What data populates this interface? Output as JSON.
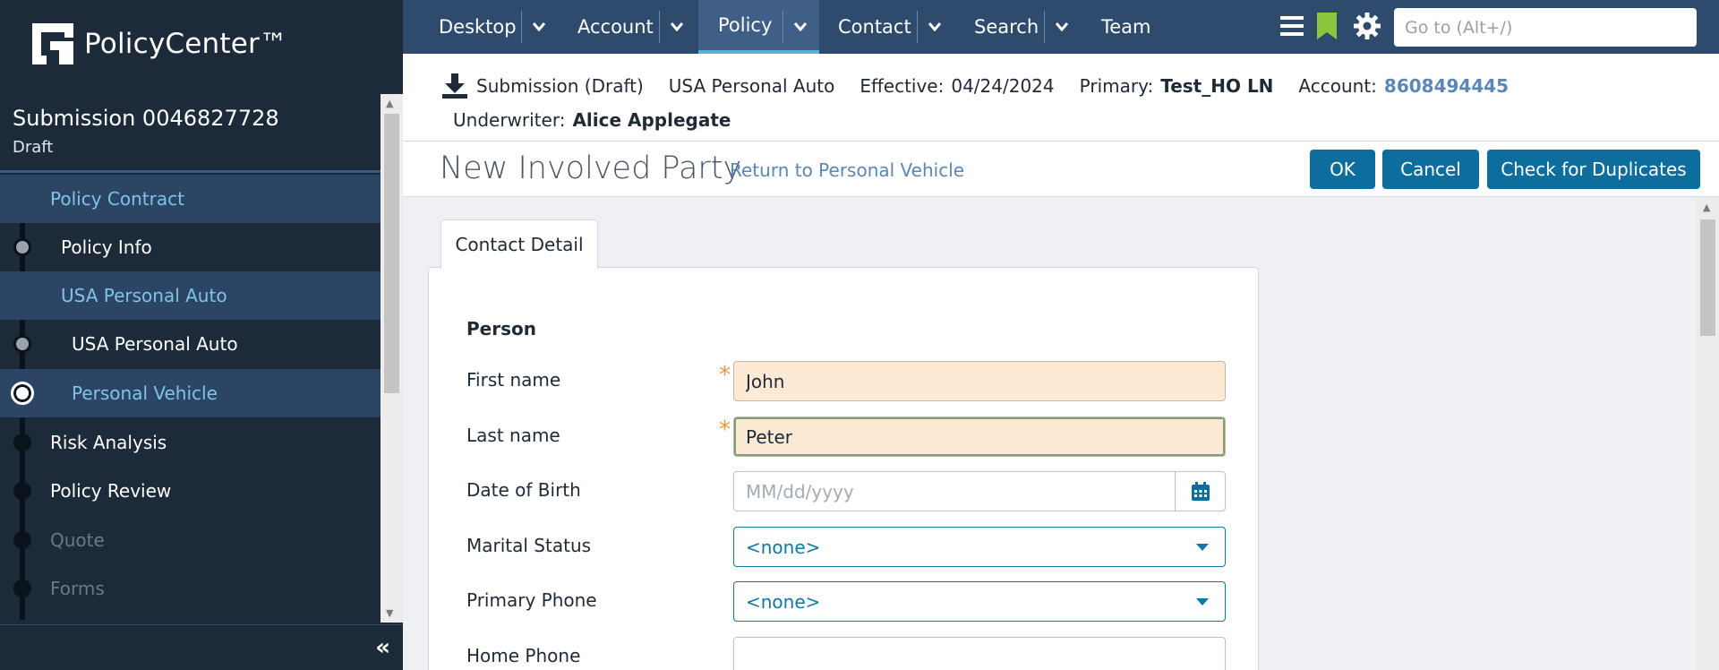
{
  "app": {
    "name": "PolicyCenter™"
  },
  "sidebar": {
    "job_title": "Submission 0046827728",
    "job_status": "Draft",
    "items": [
      {
        "label": "Policy Contract"
      },
      {
        "label": "Policy Info"
      },
      {
        "label": "USA Personal Auto"
      },
      {
        "label": "USA Personal Auto"
      },
      {
        "label": "Personal Vehicle"
      },
      {
        "label": "Risk Analysis"
      },
      {
        "label": "Policy Review"
      },
      {
        "label": "Quote"
      },
      {
        "label": "Forms"
      }
    ],
    "collapse_glyph": "«"
  },
  "topnav": {
    "tabs": [
      {
        "label": "Desktop"
      },
      {
        "label": "Account"
      },
      {
        "label": "Policy"
      },
      {
        "label": "Contact"
      },
      {
        "label": "Search"
      },
      {
        "label": "Team"
      }
    ],
    "goto_placeholder": "Go to (Alt+/)"
  },
  "infobar": {
    "job": "Submission (Draft)",
    "product": "USA Personal Auto",
    "effective_label": "Effective:",
    "effective_value": "04/24/2024",
    "primary_label": "Primary:",
    "primary_value": "Test_HO LN",
    "account_label": "Account:",
    "account_value": "8608494445",
    "underwriter_label": "Underwriter:",
    "underwriter_value": "Alice Applegate"
  },
  "page": {
    "title": "New Involved Party",
    "return_link": "Return to Personal Vehicle",
    "buttons": {
      "ok": "OK",
      "cancel": "Cancel",
      "check_duplicates": "Check for Duplicates"
    }
  },
  "form": {
    "tab": "Contact Detail",
    "section": "Person",
    "first_name": {
      "label": "First name",
      "value": "John"
    },
    "last_name": {
      "label": "Last name",
      "value": "Peter"
    },
    "dob": {
      "label": "Date of Birth",
      "placeholder": "MM/dd/yyyy"
    },
    "marital_status": {
      "label": "Marital Status",
      "value": "<none>"
    },
    "primary_phone": {
      "label": "Primary Phone",
      "value": "<none>"
    },
    "home_phone": {
      "label": "Home Phone",
      "value": ""
    }
  },
  "colors": {
    "sidebar_bg": "#1c2a3a",
    "topbar_bg": "#2e4a6c",
    "primary_button": "#0d6d9c",
    "required_field": "#fde9d4",
    "link": "#5b86b6"
  }
}
